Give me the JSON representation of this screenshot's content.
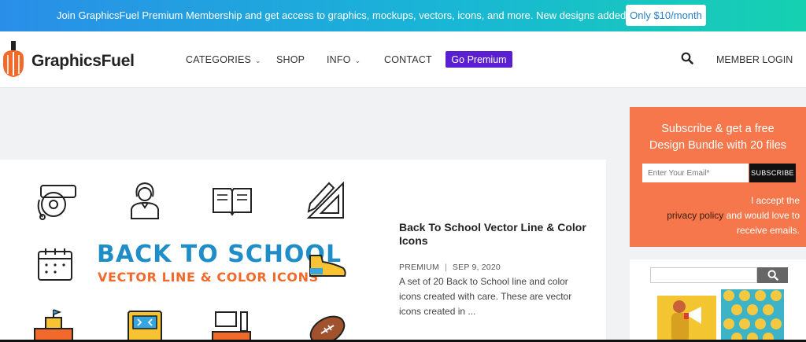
{
  "topbar": {
    "message": "Join GraphicsFuel Premium Membership and get access to graphics, mockups, vectors, icons, and more. New designs added weekly!",
    "cta": "Only $10/month"
  },
  "header": {
    "logo_text": "GraphicsFuel",
    "nav": {
      "categories": "CATEGORIES",
      "shop": "SHOP",
      "info": "INFO",
      "contact": "CONTACT",
      "premium": "Go Premium"
    },
    "member_login": "MEMBER LOGIN",
    "brand_color": "#5a1fd1"
  },
  "post": {
    "image_title": "BACK TO SCHOOL",
    "image_subtitle": "VECTOR LINE & COLOR ICONS",
    "title": "Back To School Vector Line & Color Icons",
    "category": "PREMIUM",
    "date": "SEP 9, 2020",
    "excerpt": "A set of 20 Back to School line and color icons created with care. These are vector icons created in ..."
  },
  "subscribe": {
    "title_line1": "Subscribe & get a free",
    "title_line2": "Design Bundle with 20 files",
    "placeholder": "Enter Your Email*",
    "button": "SUBSCRIBE",
    "note_before": "I accept the",
    "note_link": "privacy policy",
    "note_after": "and would love to receive emails.",
    "bg_color": "#f6774b"
  },
  "icons": [
    "logo-pencil-icon",
    "bell-icon",
    "teacher-icon",
    "book-icon",
    "pencil-ruler-icon",
    "calendar-icon",
    "sneaker-icon",
    "school-building-icon",
    "chalkboard-icon",
    "desk-icon",
    "football-icon",
    "search-icon",
    "chevron-down-icon"
  ]
}
